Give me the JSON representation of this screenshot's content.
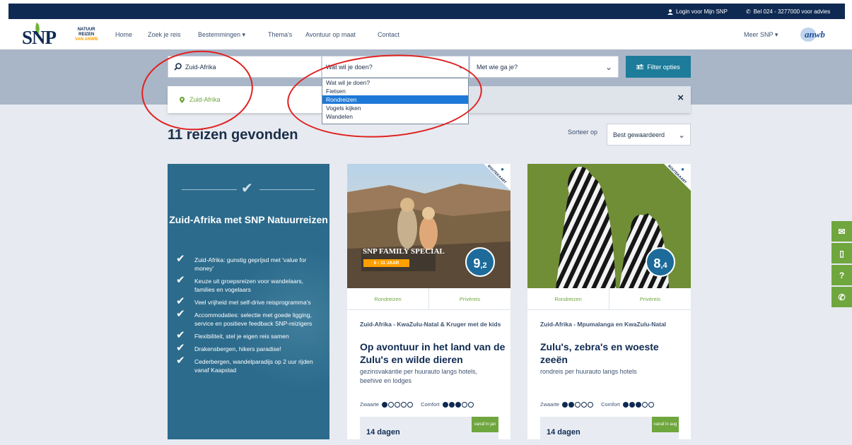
{
  "topbar": {
    "login": "Login voor Mijn SNP",
    "phone": "Bel 024 - 3277000 voor advies"
  },
  "logo": {
    "text": "SNP",
    "sub1": "NATUUR",
    "sub2": "REIZEN",
    "sub3": "VAN ANWB",
    "partner": "anwb"
  },
  "nav": {
    "items": [
      "Home",
      "Zoek je reis",
      "Bestemmingen",
      "Thema's",
      "Avontuur op maat",
      "Contact"
    ],
    "more": "Meer SNP"
  },
  "search": {
    "destination": "Zuid-Afrika",
    "activity_placeholder": "Wat wil je doen?",
    "company_placeholder": "Met wie ga je?",
    "filter_button": "Filter opties",
    "suggestion": "Zuid-Afrika",
    "close": "×",
    "dropdown_options": [
      "Wat wil je doen?",
      "Fietsen",
      "Rondreizen",
      "Vogels kijken",
      "Wandelen"
    ],
    "dropdown_selected": "Rondreizen"
  },
  "results": {
    "title": "11 reizen gevonden",
    "sort_label": "Sorteer op",
    "sort_value": "Best gewaardeerd"
  },
  "promo": {
    "title": "Zuid-Afrika met SNP Natuurreizen",
    "points": [
      "Zuid-Afrika: gunstig geprijsd met 'value for money'",
      "Keuze uit groepsreizen voor wandelaars, families en vogelaars",
      "Veel vrijheid met self-drive reisprogramma's",
      "Accommodaties: selectie met goede ligging, service en positieve feedback SNP-reizigers",
      "Flexibiliteit, stel je eigen reis samen",
      "Drakensbergen, hikers paradise!",
      "Cederbergen, wandelparadijs op 2 uur rijden vanaf Kaapstad"
    ]
  },
  "cards": [
    {
      "score_int": "9",
      "score_dec": ",2",
      "badge": "ROUTEKAART",
      "family_label": "SNP FAMILY SPECIAL",
      "family_age": "6 - 11 JAAR",
      "tab1": "Rondreizen",
      "tab2": "Privéreis",
      "location": "Zuid-Afrika - KwaZulu-Natal & Kruger met de kids",
      "title": "Op avontuur in het land van de Zulu's en wilde dieren",
      "description": "gezinsvakantie per huurauto langs hotels, beehive en lodges",
      "zwaarte_label": "Zwaarte",
      "zwaarte_level": 1,
      "comfort_label": "Comfort",
      "comfort_level": 3,
      "duration": "14 dagen",
      "vanaf": "vanaf in jan"
    },
    {
      "score_int": "8",
      "score_dec": ",4",
      "badge": "ROUTEKAART",
      "tab1": "Rondreizen",
      "tab2": "Privéreis",
      "location": "Zuid-Afrika - Mpumalanga en KwaZulu-Natal",
      "title": "Zulu's, zebra's en woeste zeeën",
      "description": "rondreis per huurauto langs hotels",
      "zwaarte_label": "Zwaarte",
      "zwaarte_level": 2,
      "comfort_label": "Comfort",
      "comfort_level": 3,
      "duration": "14 dagen",
      "vanaf": "vanaf in aug"
    }
  ],
  "colors": {
    "navy": "#0f2a52",
    "green": "#6fa63e",
    "teal": "#1c7c9a",
    "annotation": "#e02020"
  }
}
